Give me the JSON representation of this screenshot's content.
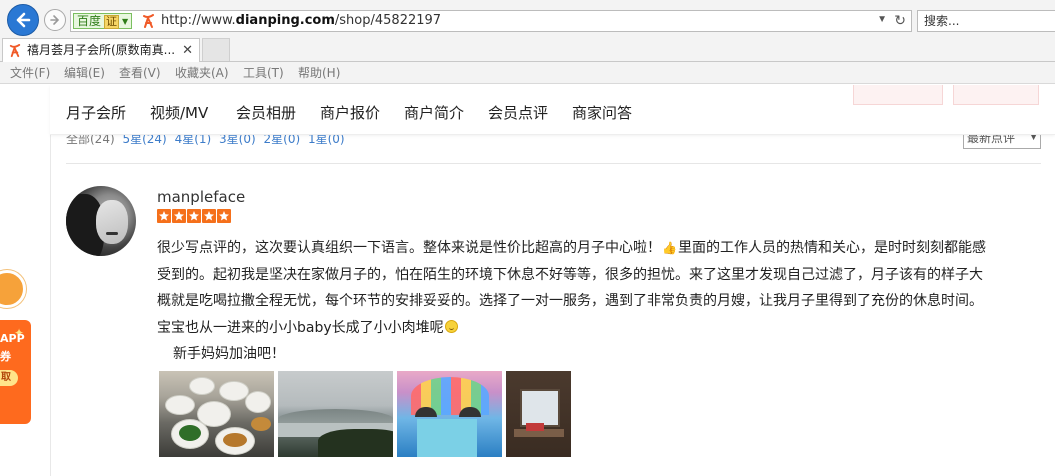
{
  "browser": {
    "address": {
      "cert_label": "百度",
      "cert_badge": "证",
      "url_prefix": "http://www.",
      "url_domain": "dianping.com",
      "url_path": "/shop/45822197"
    },
    "search_placeholder": "搜索...",
    "tab": {
      "title": "禧月荟月子会所(原数南真..."
    },
    "menu": [
      "文件(F)",
      "编辑(E)",
      "查看(V)",
      "收藏夹(A)",
      "工具(T)",
      "帮助(H)"
    ]
  },
  "nav": {
    "items": [
      "月子会所",
      "视频/MV",
      "会员相册",
      "商户报价",
      "商户简介",
      "会员点评",
      "商家问答"
    ]
  },
  "filters": {
    "items": [
      "全部(24)",
      "5星(24)",
      "4星(1)",
      "3星(0)",
      "2星(0)",
      "1星(0)"
    ],
    "sort": "最新点评"
  },
  "review": {
    "username": "manpleface",
    "rating": 5,
    "lines": [
      "很少写点评的，这次要认真组织一下语言。整体来说是性价比超高的月子中心啦！",
      "里面的工作人员的热情和关心，是时时刻刻都能感",
      "受到的。起初我是坚决在家做月子的，怕在陌生的环境下休息不好等等，很多的担忧。来了这里才发现自己过滤了，月子该有的样子大",
      "概就是吃喝拉撒全程无忧，每个环节的安排妥妥的。选择了一对一服务，遇到了非常负责的月嫂，让我月子里得到了充份的休息时间。",
      "宝宝也从一进来的小小baby长成了小小肉堆呢",
      "新手妈妈加油吧！"
    ],
    "photos": [
      "photo-dishes",
      "photo-lake-view",
      "photo-rainbow-room",
      "photo-window"
    ]
  },
  "promo": {
    "line1": "APP",
    "line2": "券",
    "pill": "取"
  },
  "colors": {
    "accent": "#f5701b",
    "link": "#3d7cc9",
    "back_button": "#2a78d4"
  }
}
